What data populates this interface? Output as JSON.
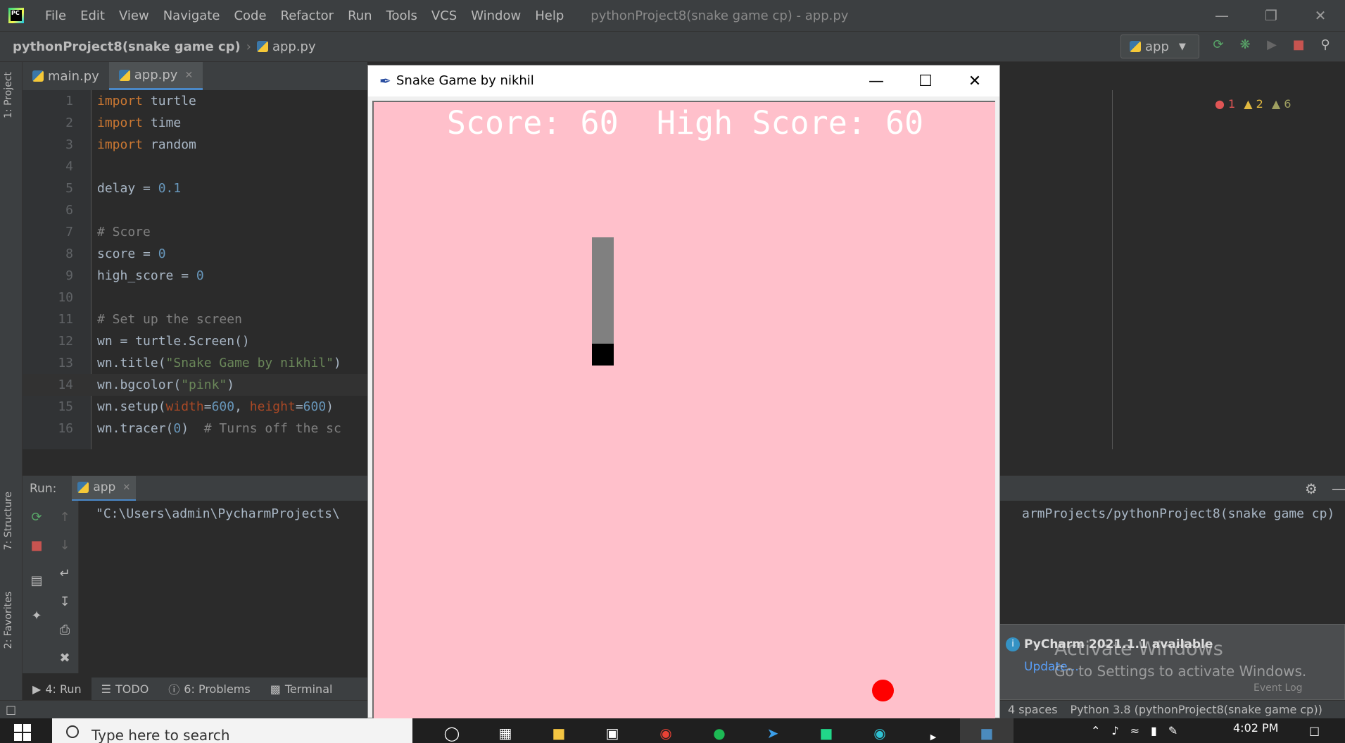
{
  "ide": {
    "menu": [
      "File",
      "Edit",
      "View",
      "Navigate",
      "Code",
      "Refactor",
      "Run",
      "Tools",
      "VCS",
      "Window",
      "Help"
    ],
    "window_title": "pythonProject8(snake game cp) - app.py",
    "breadcrumb": {
      "project": "pythonProject8(snake game cp)",
      "file": "app.py"
    },
    "run_config": "app",
    "tabs": [
      {
        "label": "main.py"
      },
      {
        "label": "app.py"
      }
    ],
    "left_tools": [
      "1: Project",
      "7: Structure",
      "2: Favorites"
    ],
    "inspections": {
      "errors": "1",
      "warnings": "2",
      "weak": "6"
    },
    "code_lines": [
      {
        "n": "1"
      },
      {
        "n": "2"
      },
      {
        "n": "3"
      },
      {
        "n": "4"
      },
      {
        "n": "5"
      },
      {
        "n": "6"
      },
      {
        "n": "7"
      },
      {
        "n": "8"
      },
      {
        "n": "9"
      },
      {
        "n": "10"
      },
      {
        "n": "11"
      },
      {
        "n": "12"
      },
      {
        "n": "13"
      },
      {
        "n": "14"
      },
      {
        "n": "15"
      },
      {
        "n": "16"
      }
    ],
    "run_panel": {
      "label": "Run:",
      "tab": "app",
      "console_left": "\"C:\\Users\\admin\\PycharmProjects\\",
      "console_right": "armProjects/pythonProject8(snake game cp)"
    },
    "bottom_tools": [
      "4: Run",
      "TODO",
      "6: Problems",
      "Terminal"
    ],
    "status": {
      "indent": "4 spaces",
      "interpreter": "Python 3.8 (pythonProject8(snake game cp))"
    },
    "notification": {
      "title": "PyCharm 2021.1.1 available",
      "link": "Update...",
      "event_log": "Event Log"
    },
    "watermark": {
      "line1": "Activate Windows",
      "line2": "Go to Settings to activate Windows."
    }
  },
  "snake_window": {
    "title": "Snake Game by nikhil",
    "score_text": "Score: 60  High Score: 60",
    "bgcolor": "#ffc0cb",
    "snake_body_color": "#808080",
    "snake_head_color": "#000000",
    "food_color": "#ff0000"
  },
  "taskbar": {
    "search_placeholder": "Type here to search",
    "clock": "4:02 PM"
  }
}
